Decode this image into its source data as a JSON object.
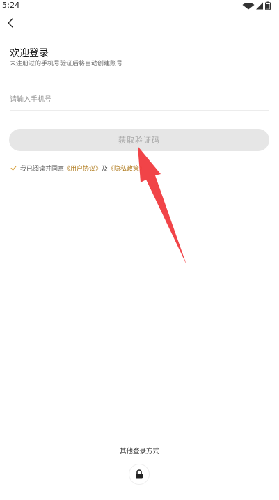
{
  "status_bar": {
    "time": "5:24",
    "icons": [
      "wifi-icon",
      "signal-icon",
      "battery-icon"
    ]
  },
  "header": {
    "back_icon": "chevron-left-icon"
  },
  "login": {
    "title": "欢迎登录",
    "subtitle": "未注册过的手机号验证后将自动创建账号",
    "phone_placeholder": "请输入手机号",
    "phone_value": "",
    "get_code_label": "获取验证码"
  },
  "agreement": {
    "checked": true,
    "prefix": "我已阅读并同意",
    "user_agreement": "《用户协议》",
    "conjunction": "及",
    "privacy_policy": "《隐私政策》"
  },
  "other_login": {
    "label": "其他登录方式",
    "lock_icon": "lock-icon"
  },
  "colors": {
    "link": "#b07a1c",
    "checkbox": "#d9a23c",
    "button_bg": "#e6e6e6",
    "button_text": "#a8a8a8",
    "annotation_arrow": "#f03a3e"
  }
}
